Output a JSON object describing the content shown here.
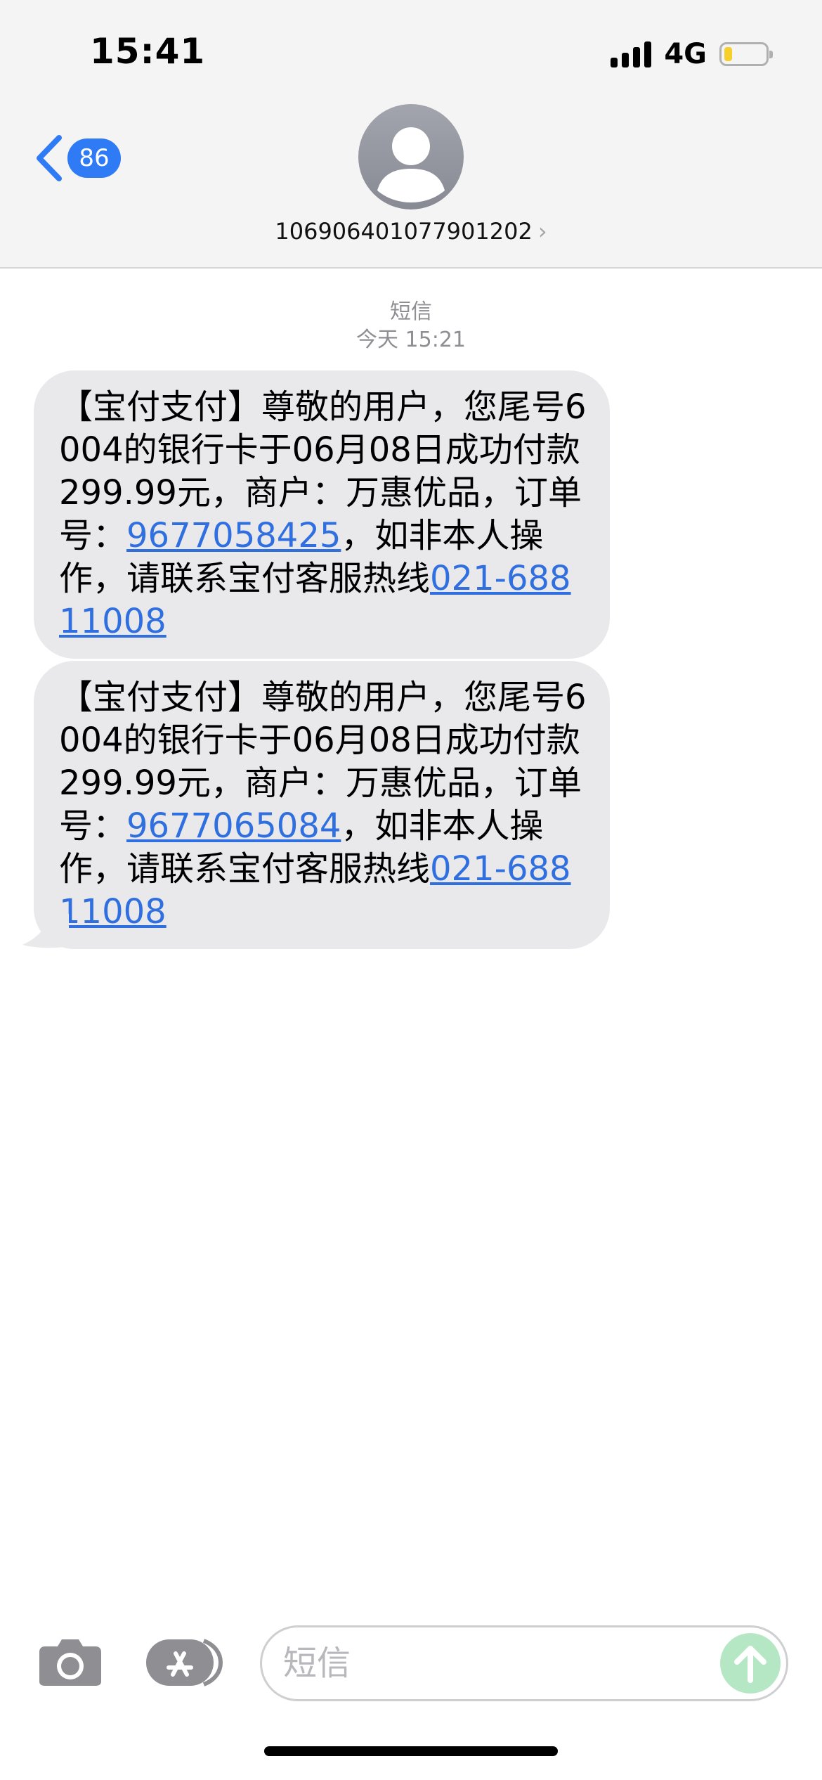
{
  "status_bar": {
    "time": "15:41",
    "network": "4G",
    "battery_level": 0.2,
    "battery_color": "#f6cf2b"
  },
  "nav": {
    "unread_count": "86",
    "contact_number": "106906401077901202",
    "chevron": "›"
  },
  "conversation": {
    "service_label": "短信",
    "date_label": "今天 15:21",
    "messages": [
      {
        "text_before": "【宝付支付】尊敬的用户，您尾号6004的银行卡于06月08日成功付款299.99元，商户：万惠优品，订单号：",
        "order_number": "9677058425",
        "text_middle": "，如非本人操作，请联系宝付客服热线",
        "hotline": "021-68811008"
      },
      {
        "text_before": "【宝付支付】尊敬的用户，您尾号6004的银行卡于06月08日成功付款299.99元，商户：万惠优品，订单号：",
        "order_number": "9677065084",
        "text_middle": "，如非本人操作，请联系宝付客服热线",
        "hotline": "021-68811008"
      }
    ]
  },
  "input_bar": {
    "placeholder": "短信",
    "camera_icon": "camera-icon",
    "apps_icon": "app-store-icon",
    "send_icon": "arrow-up-icon"
  },
  "colors": {
    "accent": "#2f7bf5",
    "link": "#2f6fe0",
    "bubble": "#e9e9eb",
    "send": "#b6e7c4"
  }
}
